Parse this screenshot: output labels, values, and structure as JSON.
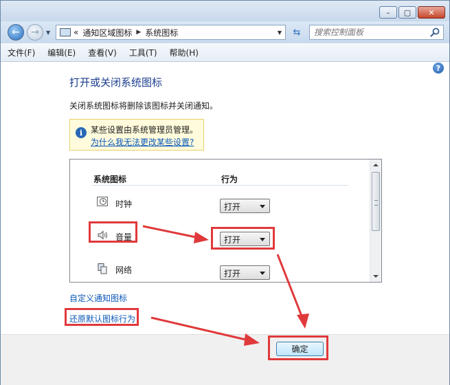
{
  "breadcrumb": {
    "parent": "通知区域图标",
    "current": "系统图标"
  },
  "search": {
    "placeholder": "搜索控制面板"
  },
  "menu": [
    "文件(F)",
    "编辑(E)",
    "查看(V)",
    "工具(T)",
    "帮助(H)"
  ],
  "page": {
    "title": "打开或关闭系统图标",
    "description": "关闭系统图标将删除该图标并关闭通知。"
  },
  "notice": {
    "text": "某些设置由系统管理员管理。",
    "link": "为什么我无法更改某些设置?"
  },
  "table": {
    "headers": [
      "系统图标",
      "行为"
    ],
    "rows": [
      {
        "icon": "clock-icon",
        "label": "时钟",
        "value": "打开"
      },
      {
        "icon": "speaker-icon",
        "label": "音量",
        "value": "打开"
      },
      {
        "icon": "network-icon",
        "label": "网络",
        "value": "打开"
      }
    ]
  },
  "links": {
    "customize": "自定义通知图标",
    "restore": "还原默认图标行为"
  },
  "footer": {
    "ok": "确定"
  },
  "colors": {
    "annotation": "#e0393b",
    "title": "#1a3d8e",
    "link": "#0b58b8"
  }
}
